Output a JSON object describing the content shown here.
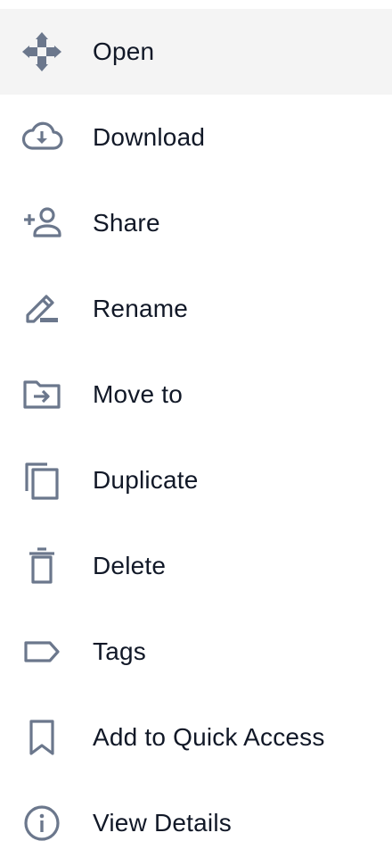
{
  "menu": {
    "items": [
      {
        "label": "Open",
        "icon": "move-arrows-icon"
      },
      {
        "label": "Download",
        "icon": "cloud-download-icon"
      },
      {
        "label": "Share",
        "icon": "person-add-icon"
      },
      {
        "label": "Rename",
        "icon": "pencil-icon"
      },
      {
        "label": "Move to",
        "icon": "folder-move-icon"
      },
      {
        "label": "Duplicate",
        "icon": "copy-icon"
      },
      {
        "label": "Delete",
        "icon": "trash-icon"
      },
      {
        "label": "Tags",
        "icon": "tag-icon"
      },
      {
        "label": "Add to Quick Access",
        "icon": "bookmark-icon"
      },
      {
        "label": "View Details",
        "icon": "info-icon"
      }
    ]
  },
  "colors": {
    "icon": "#6b778c",
    "text": "#111827",
    "active_bg": "#f4f4f4"
  }
}
